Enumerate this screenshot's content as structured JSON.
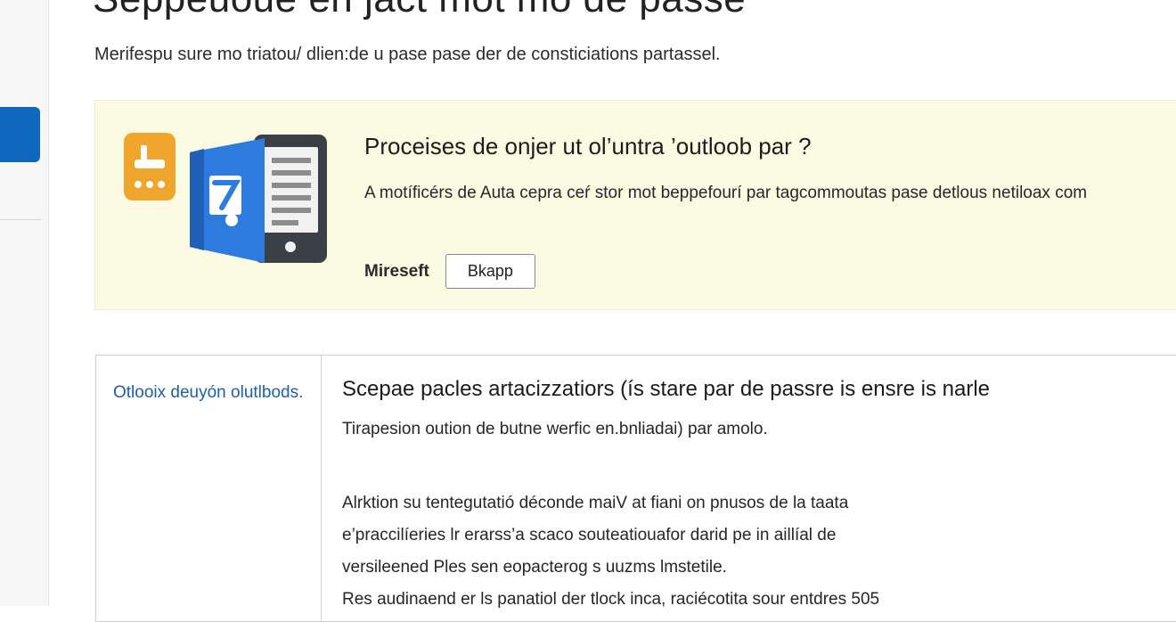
{
  "page": {
    "title": "Seppeuoue en jact mot mo de passe",
    "subtitle": "Merifespu sure mo triatou/ dlien:de u pase pase der de consticiations partassel."
  },
  "banner": {
    "title": "Proceises de onjer ut ol’untra ’outloob par ?",
    "body": "A motíficérs de Auta cepra ceŕ stor mot beppefourí par tagcommoutas pase detlous netiloax com",
    "footer_label": "Mireseft",
    "button_label": "Bkapp",
    "background": "#fbfbe4",
    "icon": "outlook-app-icon"
  },
  "detail_card": {
    "side_link": "Otlooix deuyón olutlbods.",
    "heading": "Scepae pacles artacizzatiors (ís stare par de passre is ensre is narle",
    "subheading": "Tirapesion oution de butne werfic en.bnliadai) par amolo.",
    "paragraph_lines": [
      "Alrktion su tentegutatió déconde maiV at fiani on pnusos de la taata",
      "e’praccilíeries lr erarss’a scaco souteatiouafor darid pe in aillíal de",
      "versileened Ples sen eopacterog s uuzms lmstetile.",
      "Res audinaend er ls panatiol der tlock inca, raciécotita sour entdres 505"
    ]
  },
  "colors": {
    "accent": "#0f67be",
    "link": "#1d5ea8",
    "icon_orange": "#f0a62c",
    "icon_blue": "#2e7be0"
  }
}
